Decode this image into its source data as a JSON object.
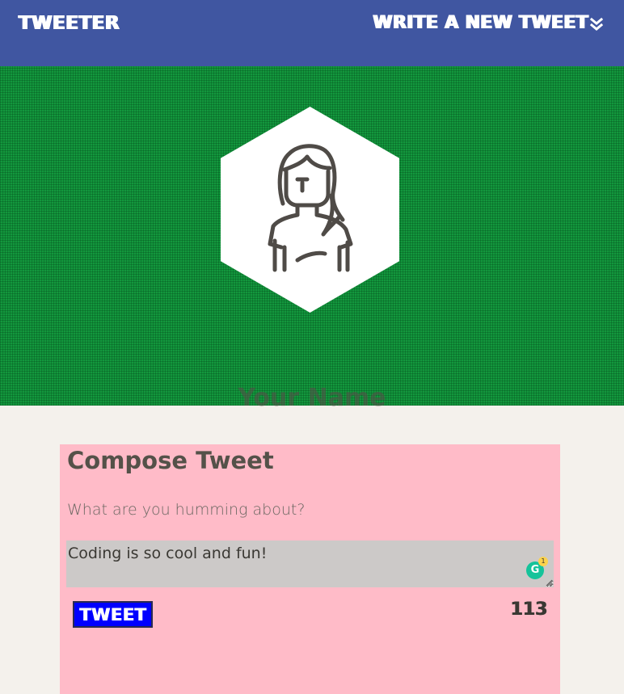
{
  "nav": {
    "brand": "TWEETER",
    "compose_toggle": "WRITE A NEW TWEET",
    "compose_toggle_icon": "double-chevron-down-icon"
  },
  "profile": {
    "avatar_icon": "female-avatar-icon",
    "name": "Your Name"
  },
  "compose": {
    "title": "Compose Tweet",
    "prompt": "What are you humming about?",
    "textarea_value": "Coding is so cool and fun!",
    "grammarly_icon": "grammarly-icon",
    "grammarly_letter": "G",
    "grammarly_count": "1",
    "tweet_button": "TWEET",
    "counter": "113"
  },
  "colors": {
    "nav_bg": "#4056a1",
    "header_bg": "#13973d",
    "page_bg": "#f4f1ec",
    "compose_bg": "#ffbbc8",
    "textarea_bg": "#ccc9c8",
    "button_bg": "#0000ff",
    "text_dark": "#545149"
  }
}
